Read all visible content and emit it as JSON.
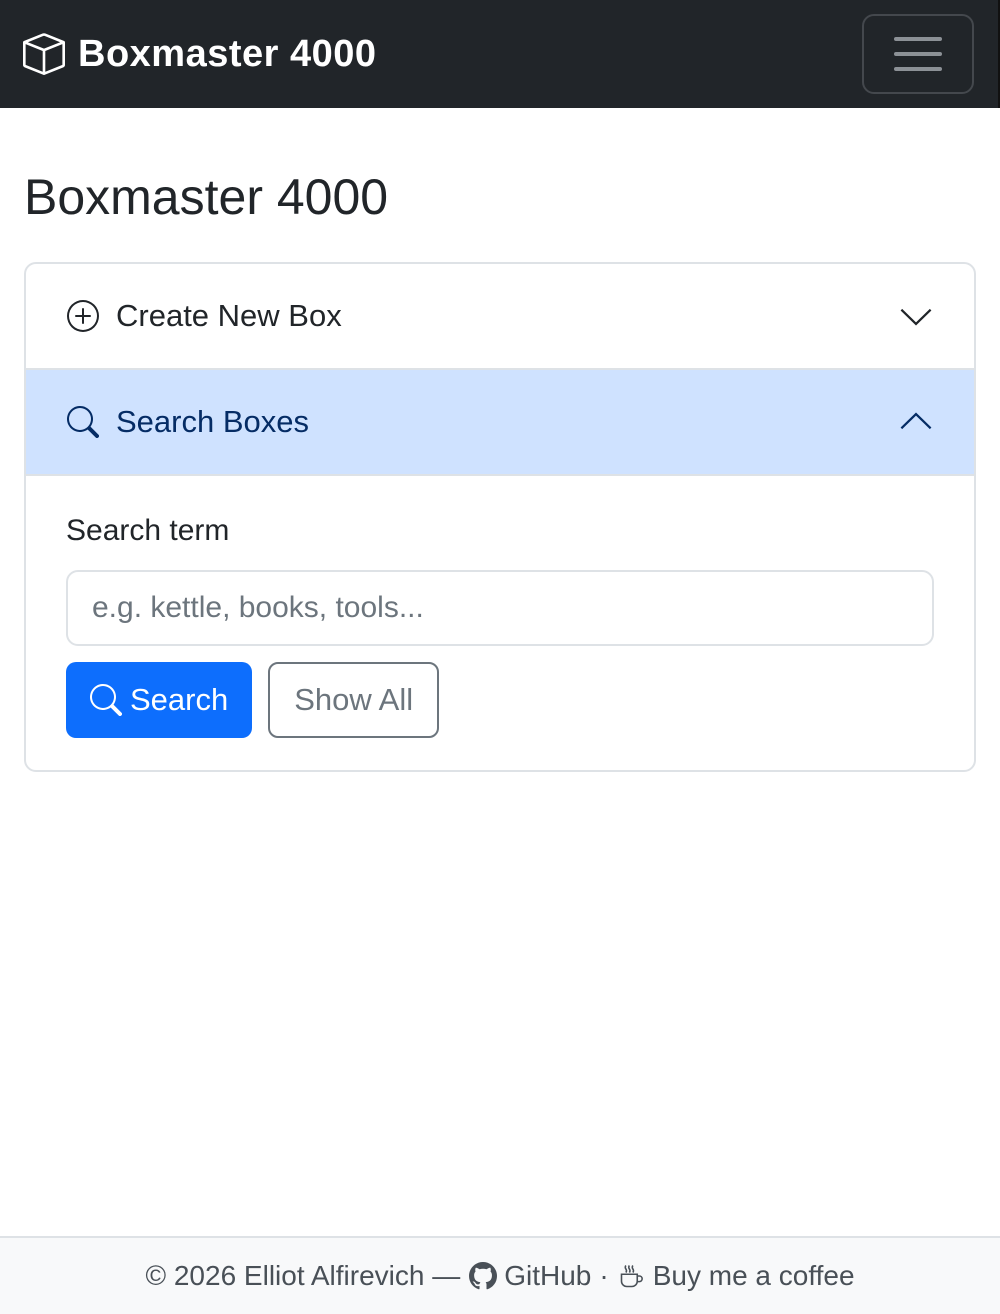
{
  "navbar": {
    "brand_icon": "box-icon",
    "brand_text": "Boxmaster 4000",
    "toggler_icon": "hamburger-menu-icon"
  },
  "page": {
    "title": "Boxmaster 4000"
  },
  "accordion": {
    "items": [
      {
        "label": "Create New Box",
        "icon": "plus-circle-icon",
        "expanded": false,
        "chevron": "chevron-down-icon"
      },
      {
        "label": "Search Boxes",
        "icon": "search-icon",
        "expanded": true,
        "chevron": "chevron-up-icon"
      }
    ]
  },
  "search": {
    "label": "Search term",
    "placeholder": "e.g. kettle, books, tools...",
    "value": "",
    "search_button": "Search",
    "search_button_icon": "search-icon",
    "show_all_button": "Show All"
  },
  "footer": {
    "copyright": "© 2026 Elliot Alfirevich —",
    "github_label": "GitHub",
    "github_icon": "github-icon",
    "separator": "·",
    "coffee_label": "Buy me a coffee",
    "coffee_icon": "coffee-cup-icon"
  },
  "colors": {
    "navbar_bg": "#212529",
    "accent": "#0d6efd",
    "active_header_bg": "#cfe2ff",
    "active_header_text": "#052c65",
    "secondary": "#6c757d"
  }
}
